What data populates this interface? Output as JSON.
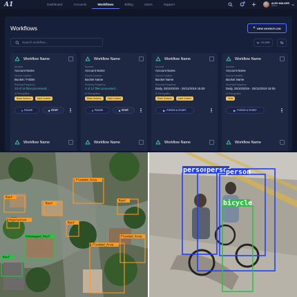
{
  "app": {
    "logo": "A1"
  },
  "nav": {
    "links": [
      "Dashboard",
      "Accounts",
      "Workflows",
      "Billing",
      "Users",
      "Support"
    ],
    "active": "Workflows"
  },
  "user": {
    "name": "ALEX WALKER",
    "role": "Admin"
  },
  "workflows": {
    "title": "Workflows",
    "new_button": "NEW WORKFLOW",
    "search_placeholder": "Search workflow...",
    "filter_label": "FILTER",
    "cards": [
      {
        "title": "Workflow Name",
        "account_label": "Account",
        "account": "Account Name",
        "source_label": "Source Location",
        "source": "Bucket / Folder",
        "freq_label": "Running Frequency",
        "freq": "10 of 14 files processed...",
        "ai_label": "AI Recognition",
        "tags": [
          "Blank Screens",
          "Adult Content"
        ],
        "primary_action": "PAUSE",
        "secondary_action": "STOP"
      },
      {
        "title": "Workflow Name",
        "account_label": "Account",
        "account": "Account Name",
        "source_label": "Source Location",
        "source": "Bucket Name",
        "freq_label": "Running Frequency",
        "freq": "4 of 12 files processed...",
        "ai_label": "AI Recognition",
        "tags": [
          "Blank Screens",
          "Adult Content"
        ],
        "primary_action": "PAUSE",
        "secondary_action": "STOP"
      },
      {
        "title": "Workflow Name",
        "account_label": "Account",
        "account": "Account Name",
        "source_label": "Source Location",
        "source": "Bucket Name",
        "freq_label": "Running Frequency",
        "freq": "Daily, 25/10/2019 - 25/11/2019 15:00",
        "ai_label": "AI Recognition",
        "tags": [
          "Blank Screens",
          "Adult Content"
        ],
        "primary_action": "FORCE A START"
      },
      {
        "title": "Workflow Name",
        "account_label": "Account",
        "account": "Account Name",
        "source_label": "Source Location",
        "source": "Bucket Name",
        "freq_label": "Running Frequency",
        "freq": "Daily, 25/10/2019 - 25/11/2019 15:00",
        "ai_label": "AI Recognition",
        "tags": [
          "Texts"
        ],
        "primary_action": "FORCE A START"
      },
      {
        "title": "Workflow Name"
      },
      {
        "title": "Workflow Name"
      },
      {
        "title": "Workflow Name"
      },
      {
        "title": "Workflow Name"
      }
    ]
  },
  "aerial_labels": [
    "Flooded_Area",
    "Flooded_Area",
    "Roof",
    "Undamaged_Roof",
    "Roof",
    "Flooded_Area",
    "Vegetation",
    "Roof",
    "Roof",
    "Roof"
  ],
  "street_labels": [
    "person",
    "person",
    "person",
    "bicycle"
  ],
  "colors": {
    "accent": "#5f78ff",
    "teal": "#38d1b0",
    "tag": "#f1c550",
    "bg": "#101626",
    "panel": "#17203a",
    "card": "#1e2843",
    "det_blue": "#1f3dff",
    "det_green": "#27c53f",
    "det_orange": "#ff9a1f"
  }
}
